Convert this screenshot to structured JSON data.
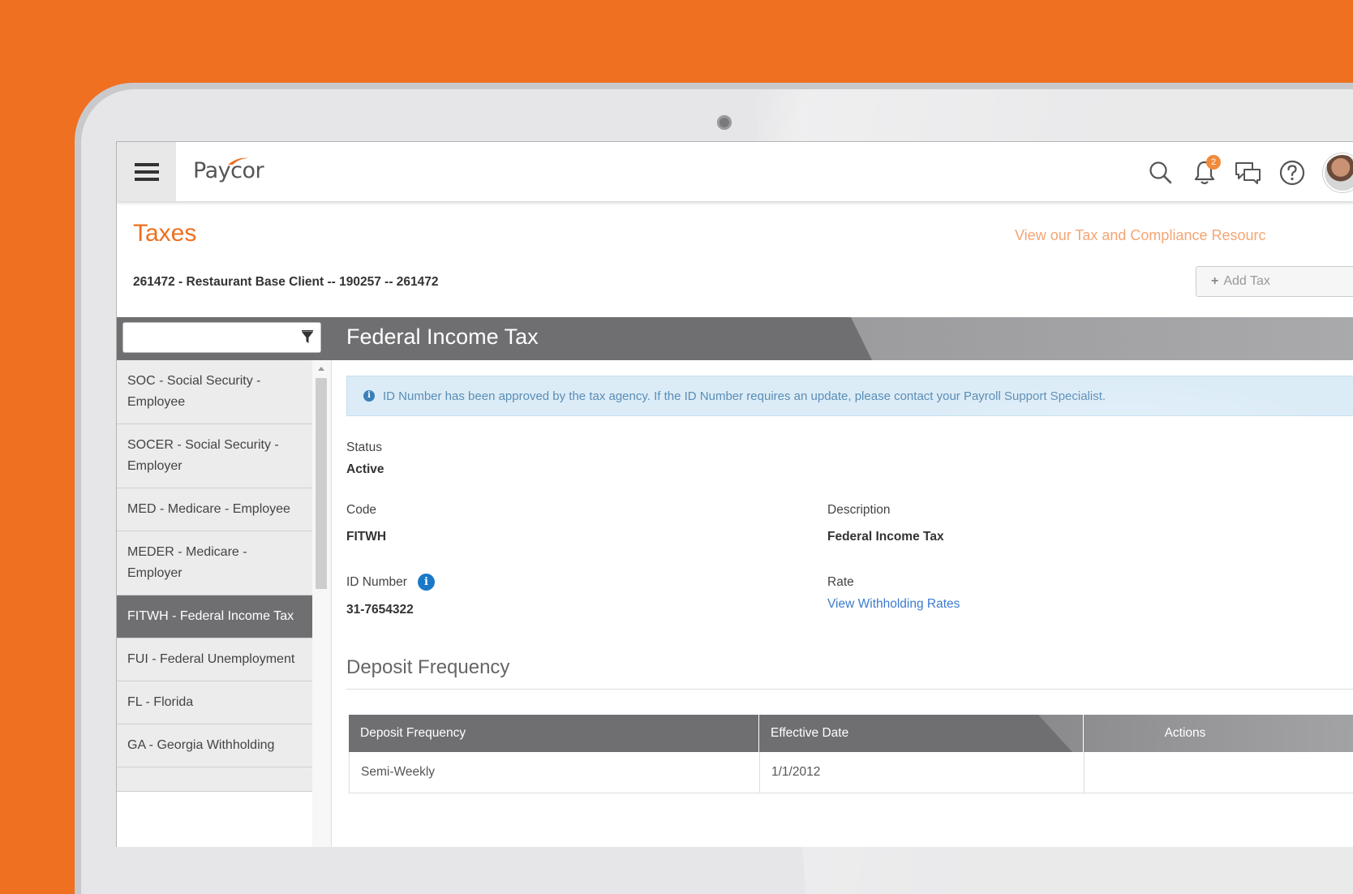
{
  "app": {
    "logo_text": "Paycor",
    "notification_count": "2"
  },
  "page": {
    "title": "Taxes",
    "resource_link": "View our Tax and Compliance Resourc",
    "client_line": "261472 - Restaurant Base Client -- 190257 -- 261472",
    "add_tax_label": "Add Tax"
  },
  "sidebar": {
    "filter_value": "",
    "items": [
      {
        "label": "SOC - Social Security - Employee",
        "active": false
      },
      {
        "label": "SOCER - Social Security - Employer",
        "active": false
      },
      {
        "label": "MED - Medicare - Employee",
        "active": false
      },
      {
        "label": "MEDER - Medicare - Employer",
        "active": false
      },
      {
        "label": "FITWH - Federal Income Tax",
        "active": true
      },
      {
        "label": "FUI - Federal Unemployment",
        "active": false
      },
      {
        "label": "FL - Florida",
        "active": false
      },
      {
        "label": "GA - Georgia Withholding",
        "active": false
      },
      {
        "label": "",
        "active": false
      }
    ]
  },
  "detail": {
    "title": "Federal Income Tax",
    "alert": "ID Number has been approved by the tax agency. If the ID Number requires an update, please contact your Payroll Support Specialist.",
    "status_label": "Status",
    "status_value": "Active",
    "code_label": "Code",
    "code_value": "FITWH",
    "description_label": "Description",
    "description_value": "Federal Income Tax",
    "id_label": "ID Number",
    "id_value": "31-7654322",
    "rate_label": "Rate",
    "rate_link": "View Withholding Rates"
  },
  "deposit": {
    "section_title": "Deposit Frequency",
    "columns": [
      "Deposit Frequency",
      "Effective Date",
      "Actions"
    ],
    "rows": [
      {
        "frequency": "Semi-Weekly",
        "effective_date": "1/1/2012",
        "actions": ""
      }
    ]
  },
  "colors": {
    "brand_orange": "#ee7020",
    "band_gray": "#6f6f72",
    "link_blue": "#3b7bd0",
    "alert_bg": "#dcecf7"
  }
}
